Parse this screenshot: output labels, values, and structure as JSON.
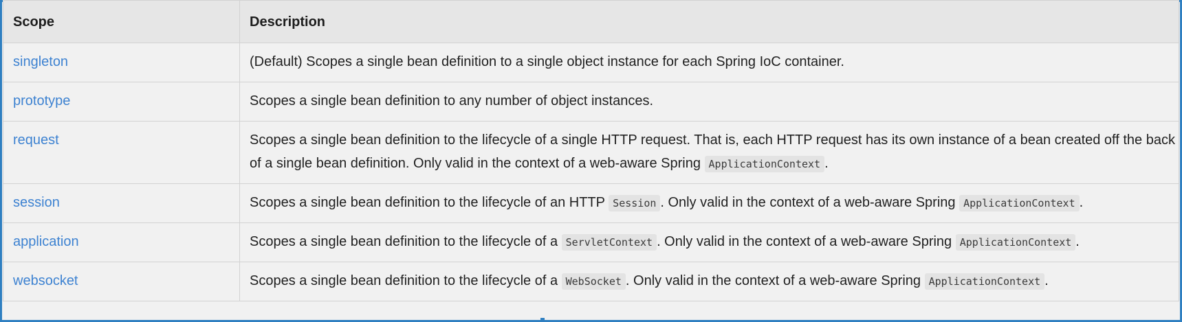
{
  "table": {
    "headers": {
      "scope": "Scope",
      "description": "Description"
    },
    "rows": [
      {
        "scope": "singleton",
        "parts": [
          {
            "text": "(Default) Scopes a single bean definition to a single object instance for each Spring IoC container."
          }
        ]
      },
      {
        "scope": "prototype",
        "parts": [
          {
            "text": "Scopes a single bean definition to any number of object instances."
          }
        ]
      },
      {
        "scope": "request",
        "parts": [
          {
            "text": "Scopes a single bean definition to the lifecycle of a single HTTP request. That is, each HTTP request has its own instance of a bean created off the back of a single bean definition. Only valid in the context of a web-aware Spring "
          },
          {
            "code": "ApplicationContext"
          },
          {
            "text": "."
          }
        ]
      },
      {
        "scope": "session",
        "parts": [
          {
            "text": "Scopes a single bean definition to the lifecycle of an HTTP "
          },
          {
            "code": "Session"
          },
          {
            "text": ". Only valid in the context of a web-aware Spring "
          },
          {
            "code": "ApplicationContext"
          },
          {
            "text": "."
          }
        ]
      },
      {
        "scope": "application",
        "parts": [
          {
            "text": "Scopes a single bean definition to the lifecycle of a "
          },
          {
            "code": "ServletContext"
          },
          {
            "text": ". Only valid in the context of a web-aware Spring "
          },
          {
            "code": "ApplicationContext"
          },
          {
            "text": "."
          }
        ]
      },
      {
        "scope": "websocket",
        "parts": [
          {
            "text": "Scopes a single bean definition to the lifecycle of a "
          },
          {
            "code": "WebSocket"
          },
          {
            "text": ". Only valid in the context of a web-aware Spring "
          },
          {
            "code": "ApplicationContext"
          },
          {
            "text": "."
          }
        ]
      }
    ]
  },
  "colors": {
    "link": "#3d82d1",
    "header_bg": "#e6e6e6",
    "row_bg": "#f1f1f1",
    "border": "#d2d2d2",
    "selection_frame": "#2f7fc1"
  }
}
